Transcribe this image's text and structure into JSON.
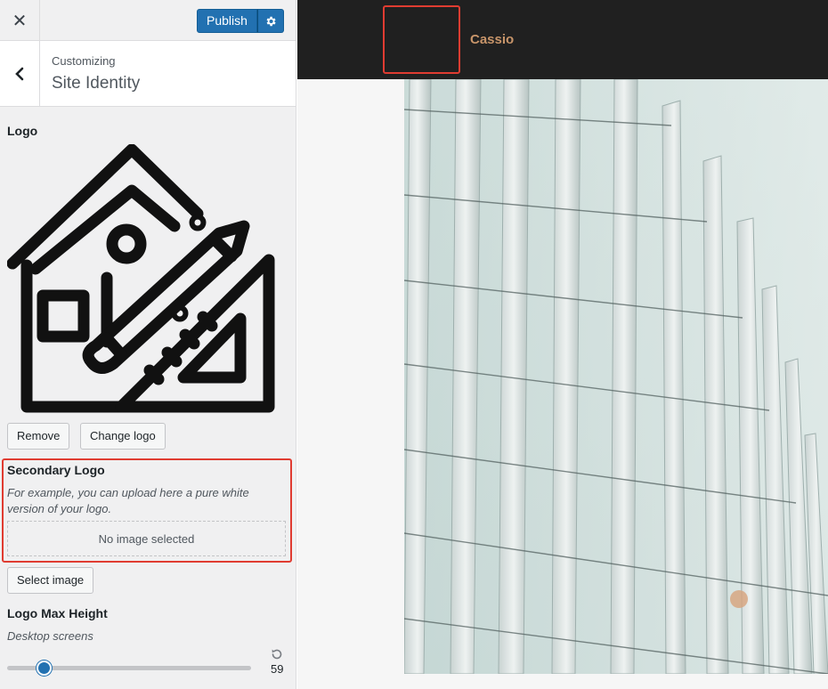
{
  "topbar": {
    "close_icon": "close-icon",
    "publish_label": "Publish",
    "gear_icon": "gear-icon",
    "accent_color": "#2271b1"
  },
  "section": {
    "subtitle": "Customizing",
    "title": "Site Identity",
    "back_icon": "chevron-left-icon"
  },
  "logo": {
    "label": "Logo",
    "remove_label": "Remove",
    "change_label": "Change logo"
  },
  "secondary_logo": {
    "label": "Secondary Logo",
    "description": "For example, you can upload here a pure white version of your logo.",
    "empty_text": "No image selected",
    "select_label": "Select image",
    "highlight_color": "#e03c31"
  },
  "logo_max_height": {
    "label": "Logo Max Height",
    "sublabel": "Desktop screens",
    "value": "59",
    "slider_fraction": 0.15,
    "reset_icon": "reset-icon"
  },
  "preview": {
    "site_title": "Cassio",
    "header_color": "#202020",
    "title_color": "#c8956a"
  }
}
